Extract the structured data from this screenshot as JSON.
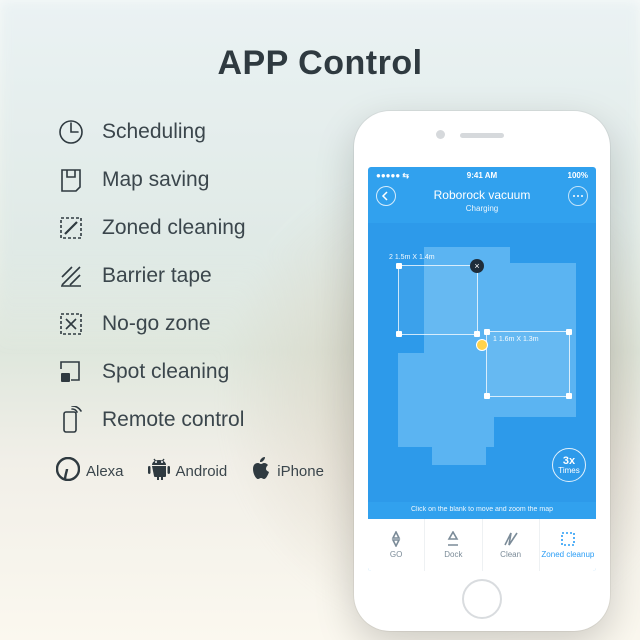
{
  "title": "APP Control",
  "features": [
    {
      "label": "Scheduling"
    },
    {
      "label": "Map saving"
    },
    {
      "label": "Zoned cleaning"
    },
    {
      "label": "Barrier tape"
    },
    {
      "label": "No-go zone"
    },
    {
      "label": "Spot cleaning"
    },
    {
      "label": "Remote control"
    }
  ],
  "compat": {
    "alexa": "Alexa",
    "android": "Android",
    "iphone": "iPhone"
  },
  "phone": {
    "status_bar": {
      "carrier": "●●●●● ⇆",
      "time": "9:41 AM",
      "battery": "100%"
    },
    "device_name": "Roborock vacuum",
    "device_status": "Charging",
    "zone1_label": "2  1.5m X 1.4m",
    "zone2_label": "1  1.6m X 1.3m",
    "times": {
      "count": "3x",
      "unit": "Times"
    },
    "hint": "Click on the blank to move and zoom the map",
    "tabs": {
      "go": "GO",
      "dock": "Dock",
      "clean": "Clean",
      "zoned": "Zoned cleanup"
    }
  }
}
